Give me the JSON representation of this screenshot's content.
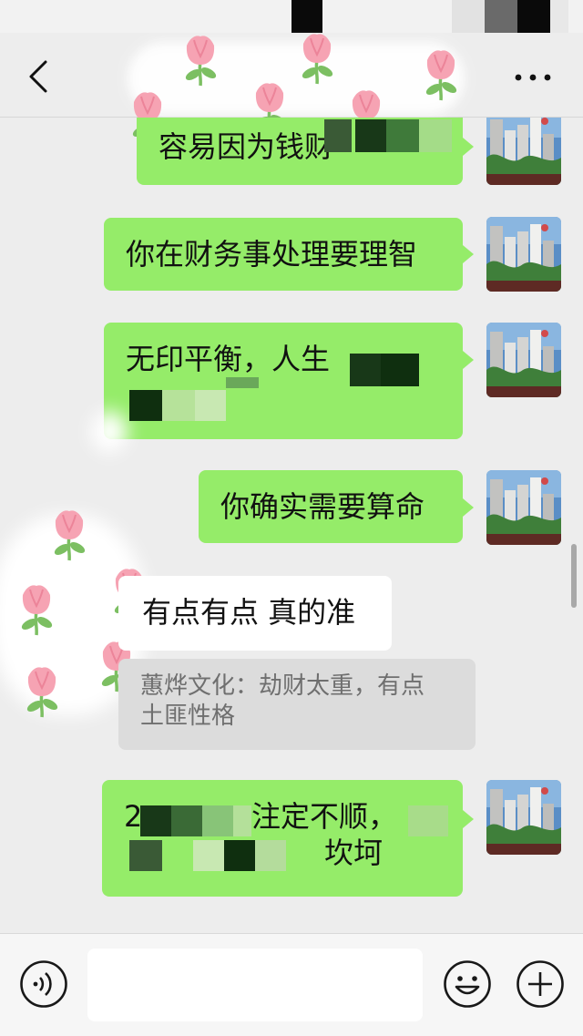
{
  "nav": {
    "back_icon": "chevron-left-icon",
    "more_icon": "more-dots-icon"
  },
  "messages": [
    {
      "side": "right",
      "text": "容易因为钱财",
      "obscured": true
    },
    {
      "side": "right",
      "text": "你在财务事处理要理智"
    },
    {
      "side": "right",
      "line1": "无印平衡，人生",
      "obscured": true
    },
    {
      "side": "right",
      "text": "你确实需要算命"
    },
    {
      "side": "left",
      "text": "有点有点 真的准"
    },
    {
      "side": "right",
      "line1_prefix": "2",
      "line1": "注定不顺，",
      "line2_suffix": "坎坷",
      "obscured": true
    }
  ],
  "quote": {
    "line1": "蕙烨文化：劫财太重，有点",
    "line2": "土匪性格"
  },
  "input_bar": {
    "voice_icon": "voice-icon",
    "text_value": "",
    "emoji_icon": "emoji-icon",
    "plus_icon": "plus-icon"
  },
  "colors": {
    "background": "#ededed",
    "bubble_green": "#95ec69",
    "bubble_white": "#ffffff",
    "quote_bg": "#dcdcdc",
    "quote_text": "#6f6f6f",
    "mosaic_dark": "#183818",
    "mosaic_mid": "#3f7a3a"
  }
}
